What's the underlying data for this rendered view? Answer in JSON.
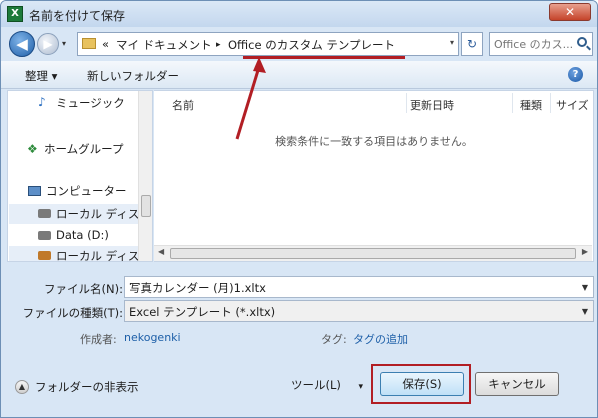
{
  "window": {
    "title": "名前を付けて保存",
    "app_icon": "X",
    "close": "✕"
  },
  "nav": {
    "back": "◀",
    "forward": "▶",
    "dropdown": "▾"
  },
  "address": {
    "prefix": "«",
    "crumbs": [
      "マイ ドキュメント",
      "Office のカスタム テンプレート"
    ],
    "separator": "▸",
    "dropdown": "▾",
    "refresh": "↻"
  },
  "search": {
    "placeholder": "Office のカス..."
  },
  "toolbar": {
    "organize": "整理 ▾",
    "new_folder": "新しいフォルダー",
    "help": "?"
  },
  "sidebar": {
    "items": [
      "ミュージック",
      "ホームグループ",
      "コンピューター",
      "ローカル ディス",
      "Data (D:)",
      "ローカル ディス"
    ]
  },
  "filelist": {
    "columns": [
      "名前",
      "更新日時",
      "種類",
      "サイズ"
    ],
    "empty": "検索条件に一致する項目はありません。"
  },
  "form": {
    "filename_label": "ファイル名(N):",
    "filename_value": "写真カレンダー (月)1.xltx",
    "filetype_label": "ファイルの種類(T):",
    "filetype_value": "Excel テンプレート (*.xltx)",
    "author_label": "作成者:",
    "author_value": "nekogenki",
    "tags_label": "タグ:",
    "tags_value": "タグの追加"
  },
  "footer": {
    "hide_folders": "フォルダーの非表示",
    "tools": "ツール(L)",
    "tools_arrow": "▾",
    "save": "保存(S)",
    "cancel": "キャンセル"
  },
  "colors": {
    "annotation": "#b21e24",
    "link": "#1d5fa8"
  }
}
